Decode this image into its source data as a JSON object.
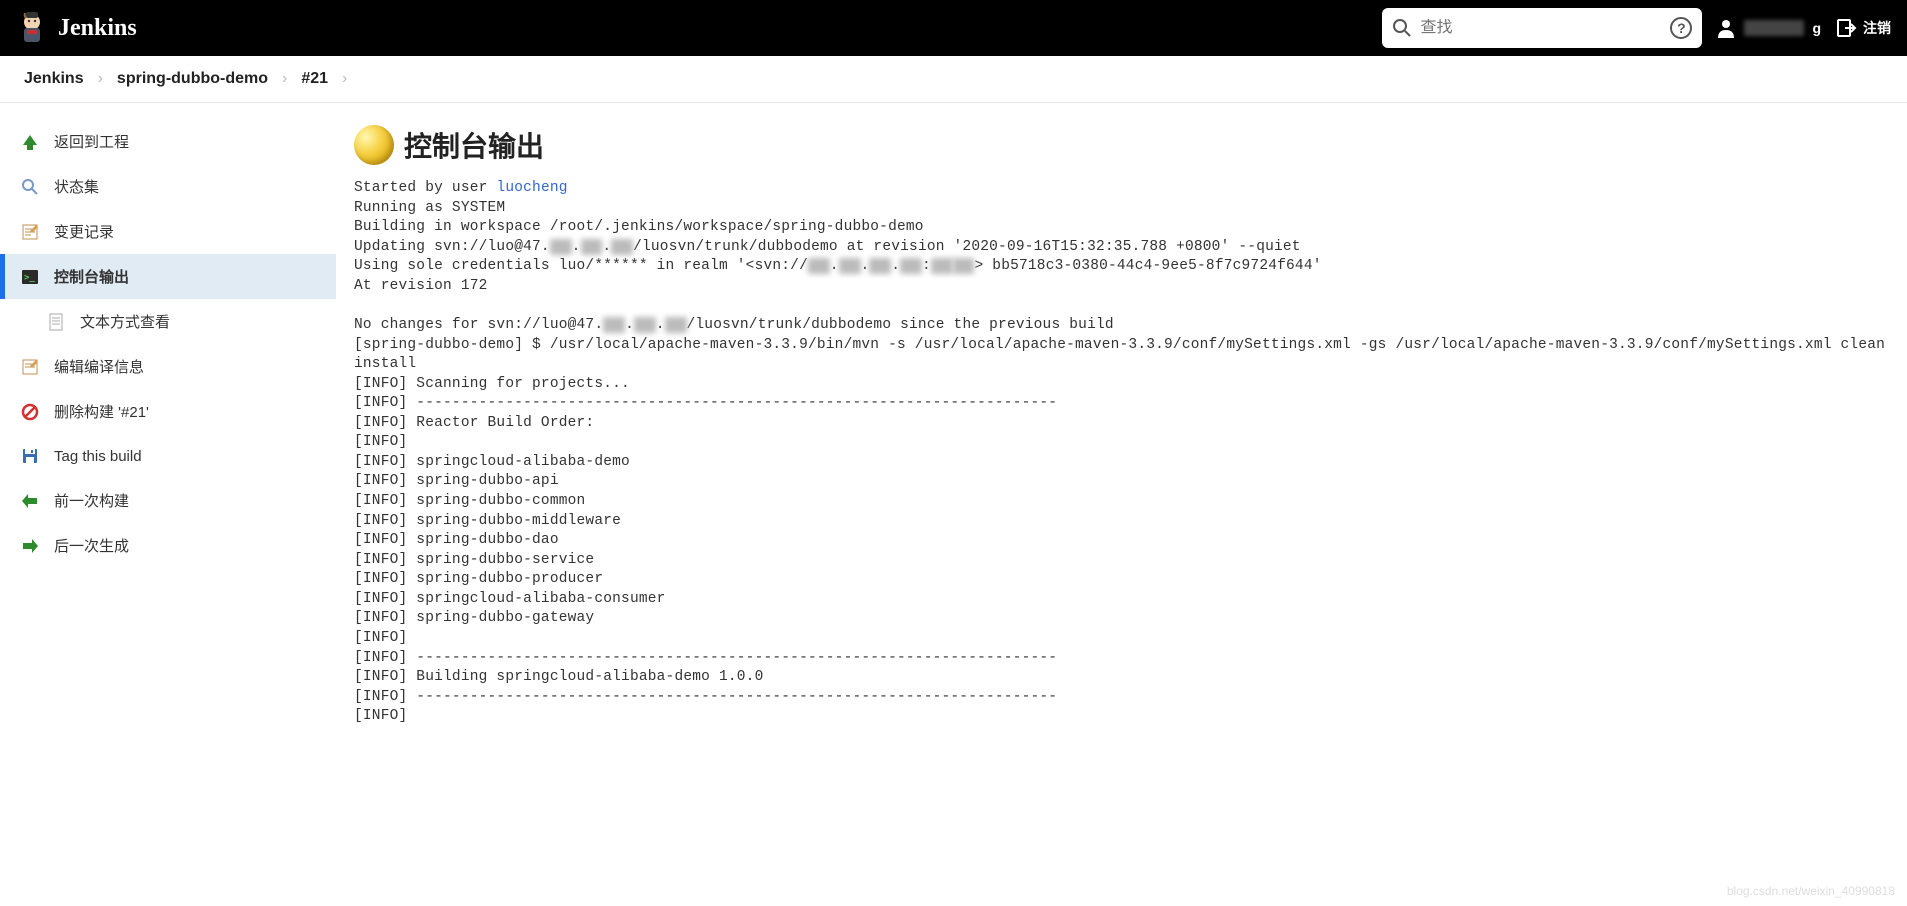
{
  "header": {
    "brand": "Jenkins",
    "search_placeholder": "查找",
    "user_suffix": "g",
    "logout": "注销"
  },
  "breadcrumb": {
    "items": [
      "Jenkins",
      "spring-dubbo-demo",
      "#21"
    ]
  },
  "sidebar": {
    "items": [
      {
        "label": "返回到工程",
        "icon": "arrow-up"
      },
      {
        "label": "状态集",
        "icon": "magnify"
      },
      {
        "label": "变更记录",
        "icon": "notepad"
      },
      {
        "label": "控制台输出",
        "icon": "terminal",
        "active": true
      },
      {
        "label": "文本方式查看",
        "icon": "document",
        "sub": true
      },
      {
        "label": "编辑编译信息",
        "icon": "notepad"
      },
      {
        "label": "删除构建 '#21'",
        "icon": "forbidden"
      },
      {
        "label": "Tag this build",
        "icon": "save"
      },
      {
        "label": "前一次构建",
        "icon": "arrow-left"
      },
      {
        "label": "后一次生成",
        "icon": "arrow-right"
      }
    ]
  },
  "page": {
    "title": "控制台输出"
  },
  "console": {
    "started_prefix": "Started by user ",
    "started_user": "luocheng",
    "lines_before_blank": [
      "Running as SYSTEM",
      "Building in workspace /root/.jenkins/workspace/spring-dubbo-demo",
      "Updating svn://luo@47.██.██.██/luosvn/trunk/dubbodemo at revision '2020-09-16T15:32:35.788 +0800' --quiet",
      "Using sole credentials luo/****** in realm '<svn://██.██.██.██:████> bb5718c3-0380-44c4-9ee5-8f7c9724f644'",
      "At revision 172"
    ],
    "lines_after_blank": [
      "No changes for svn://luo@47.██.██.██/luosvn/trunk/dubbodemo since the previous build",
      "[spring-dubbo-demo] $ /usr/local/apache-maven-3.3.9/bin/mvn -s /usr/local/apache-maven-3.3.9/conf/mySettings.xml -gs /usr/local/apache-maven-3.3.9/conf/mySettings.xml clean install",
      "[INFO] Scanning for projects...",
      "[INFO] ------------------------------------------------------------------------",
      "[INFO] Reactor Build Order:",
      "[INFO] ",
      "[INFO] springcloud-alibaba-demo",
      "[INFO] spring-dubbo-api",
      "[INFO] spring-dubbo-common",
      "[INFO] spring-dubbo-middleware",
      "[INFO] spring-dubbo-dao",
      "[INFO] spring-dubbo-service",
      "[INFO] spring-dubbo-producer",
      "[INFO] springcloud-alibaba-consumer",
      "[INFO] spring-dubbo-gateway",
      "[INFO] ",
      "[INFO] ------------------------------------------------------------------------",
      "[INFO] Building springcloud-alibaba-demo 1.0.0",
      "[INFO] ------------------------------------------------------------------------",
      "[INFO] "
    ]
  },
  "watermark": "blog.csdn.net/weixin_40990818"
}
